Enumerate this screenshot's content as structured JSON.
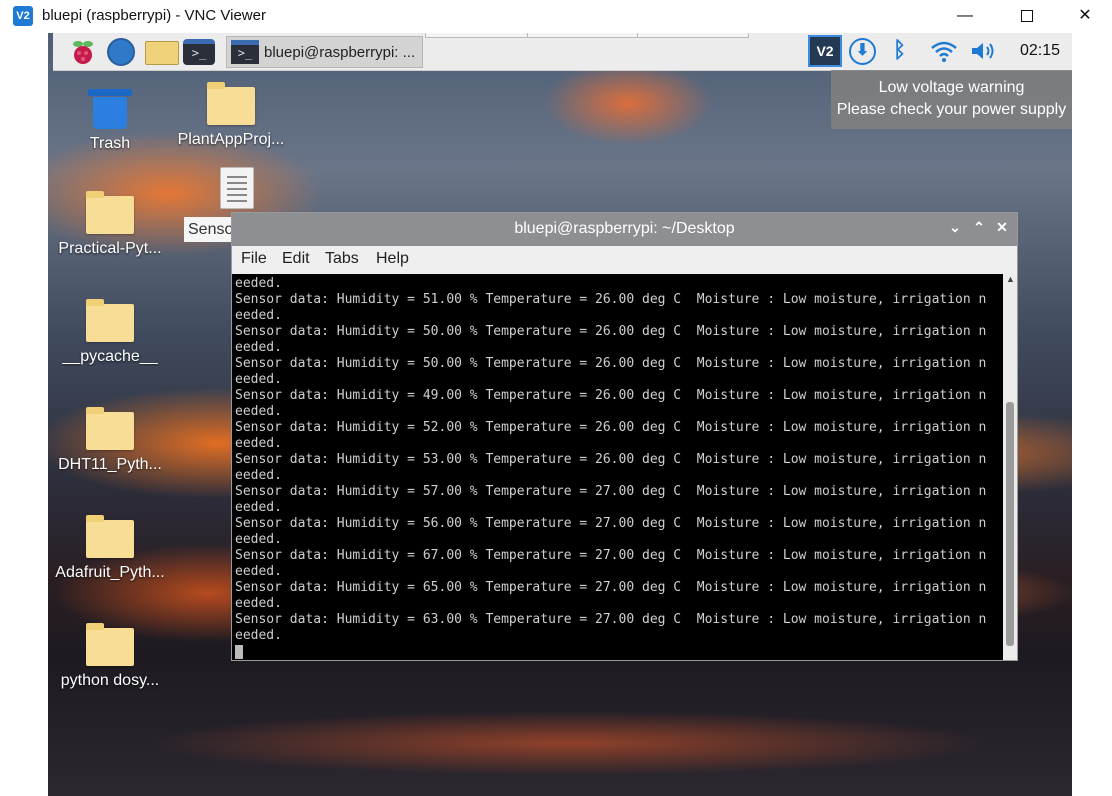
{
  "vnc_window": {
    "logo": "V2",
    "title": "bluepi (raspberrypi) - VNC Viewer",
    "minimize": "—",
    "close": "✕"
  },
  "taskbar": {
    "task_label": "bluepi@raspberrypi: ...",
    "term_glyph": ">_",
    "vnc_tray": "V2",
    "download_glyph": "⬇",
    "bluetooth_glyph": "ᛒ",
    "clock": "02:15"
  },
  "notification": {
    "line1": "Low voltage warning",
    "line2": "Please check your power supply"
  },
  "desktop_icons": {
    "trash": "Trash",
    "plant": "PlantAppProj...",
    "practical": "Practical-Pyt...",
    "pycache": "__pycache__",
    "dht11": "DHT11_Pyth...",
    "adafruit": "Adafruit_Pyth...",
    "python_dosy": "python dosy...",
    "senso": "Senso"
  },
  "terminal": {
    "title": "bluepi@raspberrypi: ~/Desktop",
    "controls": {
      "min": "⌄",
      "max": "⌃",
      "close": "✕"
    },
    "menu": [
      "File",
      "Edit",
      "Tabs",
      "Help"
    ],
    "lines": [
      "eeded.",
      "Sensor data: Humidity = 51.00 % Temperature = 26.00 deg C  Moisture : Low moisture, irrigation n",
      "eeded.",
      "Sensor data: Humidity = 50.00 % Temperature = 26.00 deg C  Moisture : Low moisture, irrigation n",
      "eeded.",
      "Sensor data: Humidity = 50.00 % Temperature = 26.00 deg C  Moisture : Low moisture, irrigation n",
      "eeded.",
      "Sensor data: Humidity = 49.00 % Temperature = 26.00 deg C  Moisture : Low moisture, irrigation n",
      "eeded.",
      "Sensor data: Humidity = 52.00 % Temperature = 26.00 deg C  Moisture : Low moisture, irrigation n",
      "eeded.",
      "Sensor data: Humidity = 53.00 % Temperature = 26.00 deg C  Moisture : Low moisture, irrigation n",
      "eeded.",
      "Sensor data: Humidity = 57.00 % Temperature = 27.00 deg C  Moisture : Low moisture, irrigation n",
      "eeded.",
      "Sensor data: Humidity = 56.00 % Temperature = 27.00 deg C  Moisture : Low moisture, irrigation n",
      "eeded.",
      "Sensor data: Humidity = 67.00 % Temperature = 27.00 deg C  Moisture : Low moisture, irrigation n",
      "eeded.",
      "Sensor data: Humidity = 65.00 % Temperature = 27.00 deg C  Moisture : Low moisture, irrigation n",
      "eeded.",
      "Sensor data: Humidity = 63.00 % Temperature = 27.00 deg C  Moisture : Low moisture, irrigation n",
      "eeded."
    ]
  }
}
